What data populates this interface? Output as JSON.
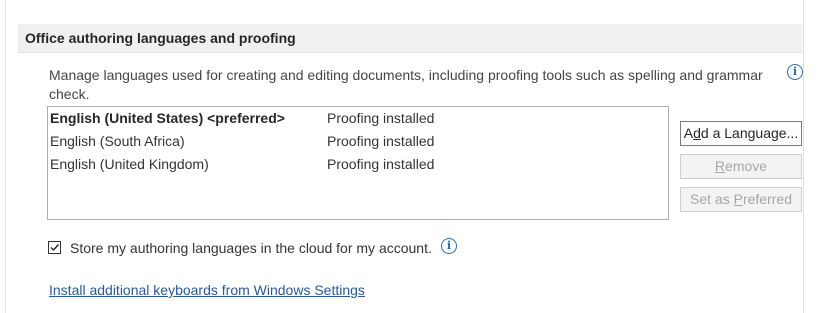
{
  "section": {
    "title": "Office authoring languages and proofing"
  },
  "description": "Manage languages used for creating and editing documents, including proofing tools such as spelling and grammar check.",
  "languages": [
    {
      "name": "English (United States) <preferred>",
      "status": "Proofing installed",
      "preferred": true
    },
    {
      "name": "English (South Africa)",
      "status": "Proofing installed",
      "preferred": false
    },
    {
      "name": "English (United Kingdom)",
      "status": "Proofing installed",
      "preferred": false
    }
  ],
  "buttons": {
    "add_pre": "A",
    "add_key": "d",
    "add_post": "d a Language...",
    "remove_key": "R",
    "remove_post": "emove",
    "setpref_pre": "Set as ",
    "setpref_key": "P",
    "setpref_post": "referred"
  },
  "cloud_option": {
    "label": "Store my authoring languages in the cloud for my account.",
    "checked": true
  },
  "link": {
    "text": "Install additional keyboards from Windows Settings"
  },
  "colors": {
    "link": "#2b5797",
    "info_icon": "#2b6cb0",
    "header_bg": "#f0f0f0"
  }
}
